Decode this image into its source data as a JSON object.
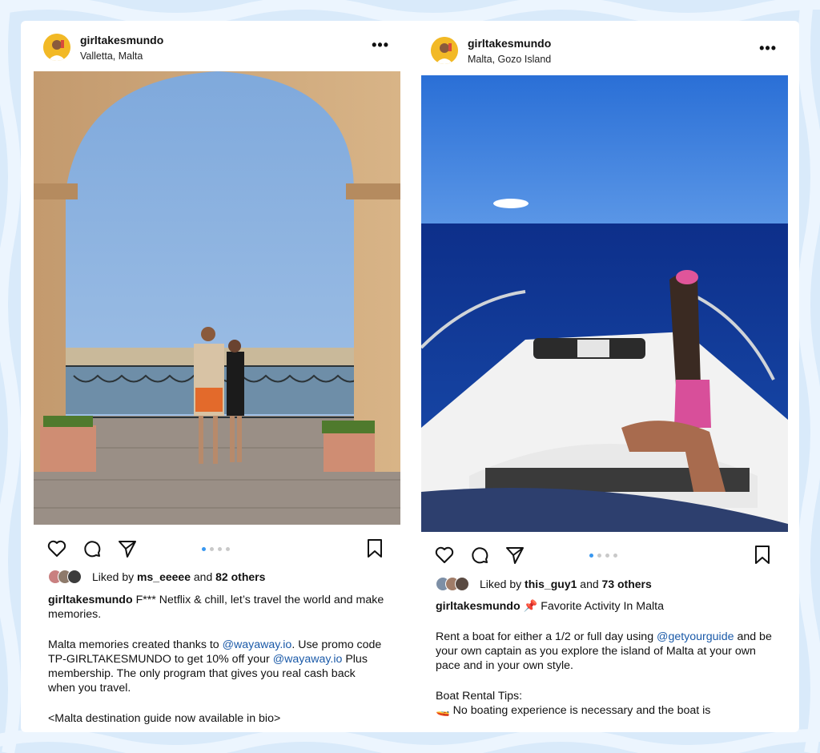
{
  "colors": {
    "background": "#d9eafa",
    "link": "#1b5aa8",
    "active_dot": "#3897f0"
  },
  "icons": [
    "heart-icon",
    "comment-icon",
    "share-icon",
    "bookmark-icon",
    "more-icon"
  ],
  "post_left": {
    "username": "girltakesmundo",
    "location": "Valletta, Malta",
    "more": "•••",
    "carousel": {
      "count": 4,
      "active": 1
    },
    "likes": {
      "prefix": "Liked by ",
      "user": "ms_eeeee",
      "middle": " and ",
      "others": "82 others"
    },
    "caption": {
      "user": "girltakesmundo",
      "line1": " F*** Netflix & chill, let’s travel the world and make memories.",
      "p2_a": "Malta memories created thanks to ",
      "mention1": "@wayaway.io",
      "p2_b": ". Use promo code TP-GIRLTAKESMUNDO to get 10% off your ",
      "mention2": "@wayaway.io",
      "p2_c": " Plus membership. The only program that gives you real cash back when you travel.",
      "p3": "<Malta destination guide now available in bio>"
    }
  },
  "post_right": {
    "username": "girltakesmundo",
    "location": "Malta, Gozo Island",
    "more": "•••",
    "carousel": {
      "count": 4,
      "active": 1
    },
    "likes": {
      "prefix": "Liked by ",
      "user": "this_guy1",
      "middle": " and ",
      "others": "73 others"
    },
    "caption": {
      "user": "girltakesmundo",
      "pin": "📌",
      "line1": " Favorite Activity In Malta",
      "p2_a": "Rent a boat for either a 1/2 or full day using ",
      "mention1": "@getyourguide",
      "p2_b": " and be your own captain as you explore the island of Malta at your own pace and in your own style.",
      "tips_title": "Boat Rental Tips:",
      "boat_emoji": "🚤",
      "tip1": " No boating experience is necessary and the boat is"
    }
  }
}
